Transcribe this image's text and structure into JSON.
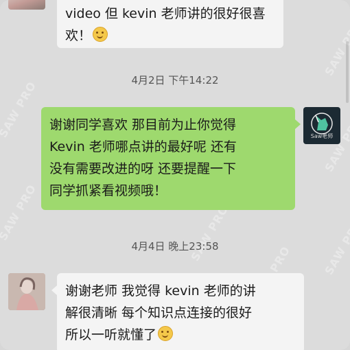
{
  "messages": [
    {
      "side": "left",
      "lines": [
        "video 但 kevin 老师讲的很好很喜",
        "欢！"
      ],
      "emoji_after_last_line": "smile-emoji"
    },
    {
      "timestamp": "4月2日 下午14:22"
    },
    {
      "side": "right",
      "lines": [
        "谢谢同学喜欢 那目前为止你觉得",
        "Kevin 老师哪点讲的最好呢 还有",
        "没有需要改进的呀 还要提醒一下",
        "同学抓紧看视频哦！"
      ],
      "avatar_caption": "Saw老师"
    },
    {
      "timestamp": "4月4日 晚上23:58"
    },
    {
      "side": "left",
      "lines": [
        "谢谢老师 我觉得 kevin 老师的讲",
        "解很清晰 每个知识点连接的很好",
        "所以一听就懂了"
      ],
      "emoji_after_last_line": "smile-emoji"
    }
  ],
  "watermark": "SAW PRO",
  "colors": {
    "background": "#dcdcdc",
    "right_bubble": "#9ed96e",
    "left_bubble": "#f4f4f4",
    "timestamp_text": "#555555"
  }
}
